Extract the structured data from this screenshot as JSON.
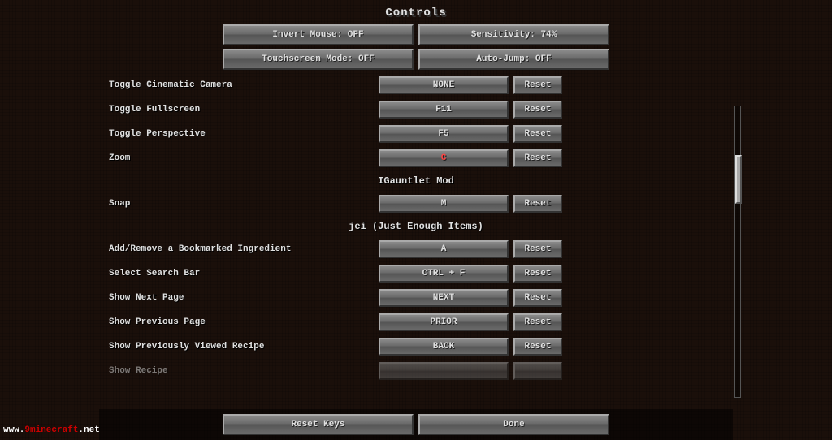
{
  "title": "Controls",
  "top_buttons": [
    {
      "label": "Invert Mouse: OFF",
      "name": "invert-mouse-btn"
    },
    {
      "label": "Sensitivity: 74%",
      "name": "sensitivity-btn"
    },
    {
      "label": "Touchscreen Mode: OFF",
      "name": "touchscreen-btn"
    },
    {
      "label": "Auto-Jump: OFF",
      "name": "autojump-btn"
    }
  ],
  "settings": [
    {
      "type": "row",
      "label": "Toggle Cinematic Camera",
      "key": "NONE",
      "conflict": false
    },
    {
      "type": "row",
      "label": "Toggle Fullscreen",
      "key": "F11",
      "conflict": false
    },
    {
      "type": "row",
      "label": "Toggle Perspective",
      "key": "F5",
      "conflict": false
    },
    {
      "type": "row",
      "label": "Zoom",
      "key": "C",
      "conflict": true
    },
    {
      "type": "header",
      "label": "IGauntlet Mod"
    },
    {
      "type": "row",
      "label": "Snap",
      "key": "M",
      "conflict": false
    },
    {
      "type": "header",
      "label": "jei (Just Enough Items)"
    },
    {
      "type": "row",
      "label": "Add/Remove a Bookmarked Ingredient",
      "key": "A",
      "conflict": false
    },
    {
      "type": "row",
      "label": "Select Search Bar",
      "key": "CTRL + F",
      "conflict": false
    },
    {
      "type": "row",
      "label": "Show Next Page",
      "key": "NEXT",
      "conflict": false
    },
    {
      "type": "row",
      "label": "Show Previous Page",
      "key": "PRIOR",
      "conflict": false
    },
    {
      "type": "row",
      "label": "Show Previously Viewed Recipe",
      "key": "BACK",
      "conflict": false
    },
    {
      "type": "row",
      "label": "Show Recipe",
      "key": "",
      "conflict": false
    }
  ],
  "bottom_buttons": [
    {
      "label": "Reset Keys",
      "name": "reset-keys-btn"
    },
    {
      "label": "Done",
      "name": "done-btn"
    }
  ],
  "watermark": {
    "prefix": "www.",
    "brand": "9minecraft",
    "suffix": ".net"
  },
  "reset_label": "Reset"
}
